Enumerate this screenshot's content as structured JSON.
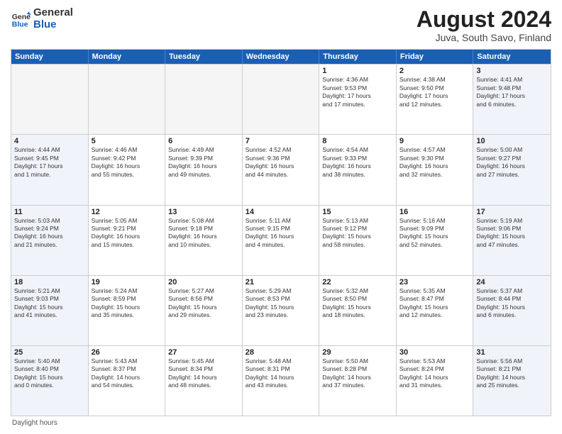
{
  "logo": {
    "general": "General",
    "blue": "Blue"
  },
  "title": "August 2024",
  "subtitle": "Juva, South Savo, Finland",
  "days_of_week": [
    "Sunday",
    "Monday",
    "Tuesday",
    "Wednesday",
    "Thursday",
    "Friday",
    "Saturday"
  ],
  "footer_note": "Daylight hours",
  "weeks": [
    [
      {
        "num": "",
        "info": "",
        "empty": true
      },
      {
        "num": "",
        "info": "",
        "empty": true
      },
      {
        "num": "",
        "info": "",
        "empty": true
      },
      {
        "num": "",
        "info": "",
        "empty": true
      },
      {
        "num": "1",
        "info": "Sunrise: 4:36 AM\nSunset: 9:53 PM\nDaylight: 17 hours\nand 17 minutes.",
        "empty": false
      },
      {
        "num": "2",
        "info": "Sunrise: 4:38 AM\nSunset: 9:50 PM\nDaylight: 17 hours\nand 12 minutes.",
        "empty": false
      },
      {
        "num": "3",
        "info": "Sunrise: 4:41 AM\nSunset: 9:48 PM\nDaylight: 17 hours\nand 6 minutes.",
        "empty": false
      }
    ],
    [
      {
        "num": "4",
        "info": "Sunrise: 4:44 AM\nSunset: 9:45 PM\nDaylight: 17 hours\nand 1 minute.",
        "empty": false
      },
      {
        "num": "5",
        "info": "Sunrise: 4:46 AM\nSunset: 9:42 PM\nDaylight: 16 hours\nand 55 minutes.",
        "empty": false
      },
      {
        "num": "6",
        "info": "Sunrise: 4:49 AM\nSunset: 9:39 PM\nDaylight: 16 hours\nand 49 minutes.",
        "empty": false
      },
      {
        "num": "7",
        "info": "Sunrise: 4:52 AM\nSunset: 9:36 PM\nDaylight: 16 hours\nand 44 minutes.",
        "empty": false
      },
      {
        "num": "8",
        "info": "Sunrise: 4:54 AM\nSunset: 9:33 PM\nDaylight: 16 hours\nand 38 minutes.",
        "empty": false
      },
      {
        "num": "9",
        "info": "Sunrise: 4:57 AM\nSunset: 9:30 PM\nDaylight: 16 hours\nand 32 minutes.",
        "empty": false
      },
      {
        "num": "10",
        "info": "Sunrise: 5:00 AM\nSunset: 9:27 PM\nDaylight: 16 hours\nand 27 minutes.",
        "empty": false
      }
    ],
    [
      {
        "num": "11",
        "info": "Sunrise: 5:03 AM\nSunset: 9:24 PM\nDaylight: 16 hours\nand 21 minutes.",
        "empty": false
      },
      {
        "num": "12",
        "info": "Sunrise: 5:05 AM\nSunset: 9:21 PM\nDaylight: 16 hours\nand 15 minutes.",
        "empty": false
      },
      {
        "num": "13",
        "info": "Sunrise: 5:08 AM\nSunset: 9:18 PM\nDaylight: 16 hours\nand 10 minutes.",
        "empty": false
      },
      {
        "num": "14",
        "info": "Sunrise: 5:11 AM\nSunset: 9:15 PM\nDaylight: 16 hours\nand 4 minutes.",
        "empty": false
      },
      {
        "num": "15",
        "info": "Sunrise: 5:13 AM\nSunset: 9:12 PM\nDaylight: 15 hours\nand 58 minutes.",
        "empty": false
      },
      {
        "num": "16",
        "info": "Sunrise: 5:16 AM\nSunset: 9:09 PM\nDaylight: 15 hours\nand 52 minutes.",
        "empty": false
      },
      {
        "num": "17",
        "info": "Sunrise: 5:19 AM\nSunset: 9:06 PM\nDaylight: 15 hours\nand 47 minutes.",
        "empty": false
      }
    ],
    [
      {
        "num": "18",
        "info": "Sunrise: 5:21 AM\nSunset: 9:03 PM\nDaylight: 15 hours\nand 41 minutes.",
        "empty": false
      },
      {
        "num": "19",
        "info": "Sunrise: 5:24 AM\nSunset: 8:59 PM\nDaylight: 15 hours\nand 35 minutes.",
        "empty": false
      },
      {
        "num": "20",
        "info": "Sunrise: 5:27 AM\nSunset: 8:56 PM\nDaylight: 15 hours\nand 29 minutes.",
        "empty": false
      },
      {
        "num": "21",
        "info": "Sunrise: 5:29 AM\nSunset: 8:53 PM\nDaylight: 15 hours\nand 23 minutes.",
        "empty": false
      },
      {
        "num": "22",
        "info": "Sunrise: 5:32 AM\nSunset: 8:50 PM\nDaylight: 15 hours\nand 18 minutes.",
        "empty": false
      },
      {
        "num": "23",
        "info": "Sunrise: 5:35 AM\nSunset: 8:47 PM\nDaylight: 15 hours\nand 12 minutes.",
        "empty": false
      },
      {
        "num": "24",
        "info": "Sunrise: 5:37 AM\nSunset: 8:44 PM\nDaylight: 15 hours\nand 6 minutes.",
        "empty": false
      }
    ],
    [
      {
        "num": "25",
        "info": "Sunrise: 5:40 AM\nSunset: 8:40 PM\nDaylight: 15 hours\nand 0 minutes.",
        "empty": false
      },
      {
        "num": "26",
        "info": "Sunrise: 5:43 AM\nSunset: 8:37 PM\nDaylight: 14 hours\nand 54 minutes.",
        "empty": false
      },
      {
        "num": "27",
        "info": "Sunrise: 5:45 AM\nSunset: 8:34 PM\nDaylight: 14 hours\nand 48 minutes.",
        "empty": false
      },
      {
        "num": "28",
        "info": "Sunrise: 5:48 AM\nSunset: 8:31 PM\nDaylight: 14 hours\nand 43 minutes.",
        "empty": false
      },
      {
        "num": "29",
        "info": "Sunrise: 5:50 AM\nSunset: 8:28 PM\nDaylight: 14 hours\nand 37 minutes.",
        "empty": false
      },
      {
        "num": "30",
        "info": "Sunrise: 5:53 AM\nSunset: 8:24 PM\nDaylight: 14 hours\nand 31 minutes.",
        "empty": false
      },
      {
        "num": "31",
        "info": "Sunrise: 5:56 AM\nSunset: 8:21 PM\nDaylight: 14 hours\nand 25 minutes.",
        "empty": false
      }
    ]
  ]
}
